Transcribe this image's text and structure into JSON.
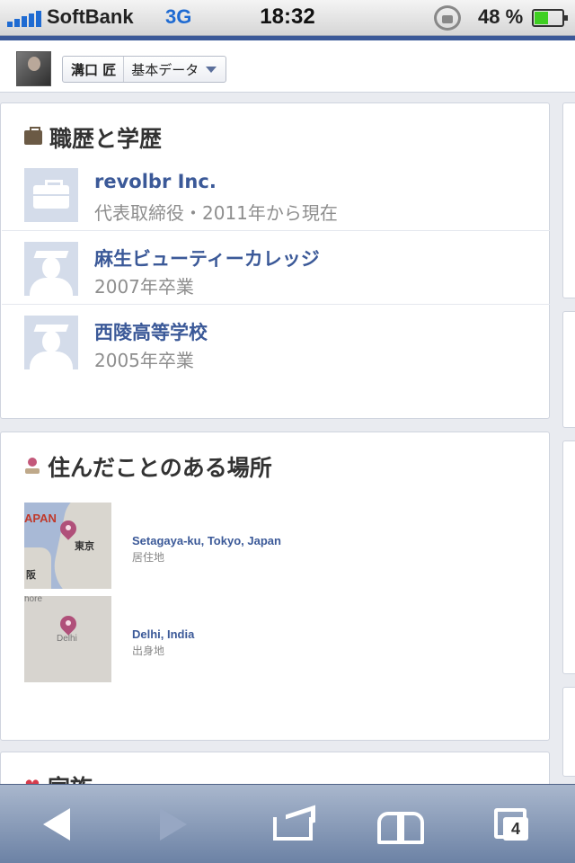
{
  "status_bar": {
    "carrier": "SoftBank",
    "network": "3G",
    "time": "18:32",
    "battery_percent": "48 %",
    "battery_level": 0.48
  },
  "header": {
    "user_name": "溝口 匠",
    "section_label": "基本データ"
  },
  "work_education": {
    "heading": "職歴と学歴",
    "items": [
      {
        "title": "revolbr Inc.",
        "subtitle": "代表取締役・2011年から現在",
        "icon": "briefcase-icon"
      },
      {
        "title": "麻生ビューティーカレッジ",
        "subtitle": "2007年卒業",
        "icon": "graduate-icon"
      },
      {
        "title": "西陵高等学校",
        "subtitle": "2005年卒業",
        "icon": "graduate-icon"
      }
    ]
  },
  "places": {
    "heading": "住んだことのある場所",
    "items": [
      {
        "name": "Setagaya-ku, Tokyo, Japan",
        "type": "居住地",
        "map_labels": [
          "APAN",
          "東京",
          "阪"
        ]
      },
      {
        "name": "Delhi, India",
        "type": "出身地",
        "map_labels": [
          "hore",
          "Delhi"
        ]
      }
    ]
  },
  "family": {
    "heading": "家族"
  },
  "toolbar": {
    "tabs_count": "4"
  },
  "colors": {
    "link_blue": "#3b5998",
    "pin_color": "#b0507a",
    "network_blue": "#1f6bd2"
  }
}
